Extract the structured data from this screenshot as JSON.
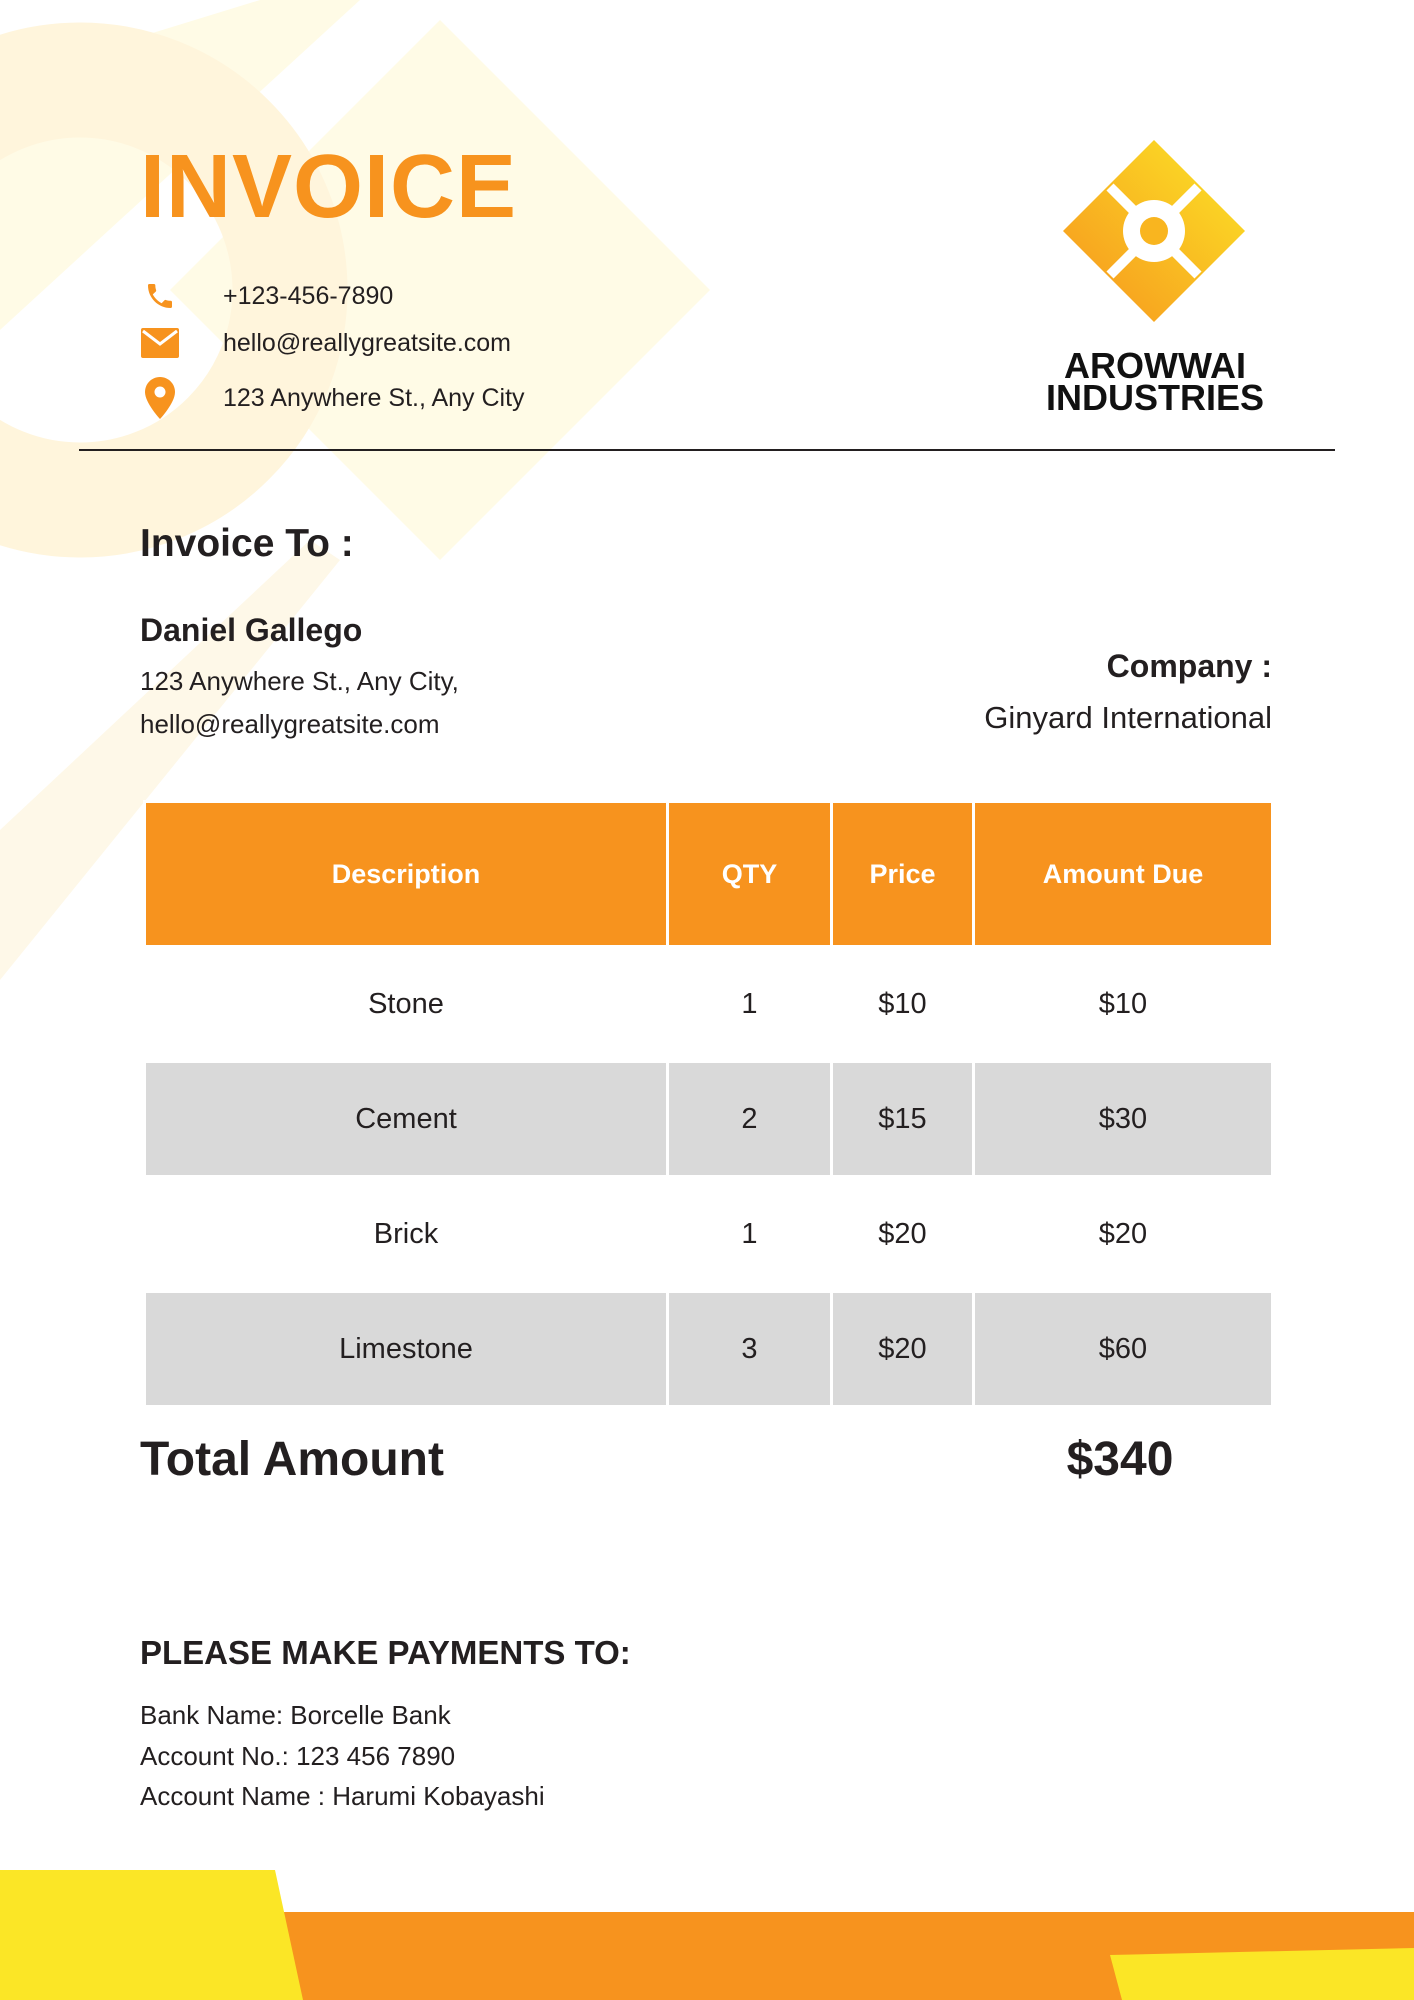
{
  "header": {
    "title": "INVOICE",
    "phone": "+123-456-7890",
    "email": "hello@reallygreatsite.com",
    "address": "123 Anywhere St., Any City",
    "icons": [
      "phone-icon",
      "mail-icon",
      "location-pin-icon"
    ]
  },
  "brand": {
    "name_line1": "AROWWAI",
    "name_line2": "INDUSTRIES",
    "logo_icon": "diamond-logo-icon"
  },
  "bill_to": {
    "heading": "Invoice To :",
    "name": "Daniel Gallego",
    "address": "123 Anywhere St., Any City,",
    "email": "hello@reallygreatsite.com",
    "company_label": "Company :",
    "company_name": "Ginyard International"
  },
  "table": {
    "headers": [
      "Description",
      "QTY",
      "Price",
      "Amount Due"
    ],
    "rows": [
      [
        "Stone",
        "1",
        "$10",
        "$10"
      ],
      [
        "Cement",
        "2",
        "$15",
        "$30"
      ],
      [
        "Brick",
        "1",
        "$20",
        "$20"
      ],
      [
        "Limestone",
        "3",
        "$20",
        "$60"
      ]
    ]
  },
  "total": {
    "label": "Total Amount",
    "value": "$340"
  },
  "payment": {
    "heading": "PLEASE MAKE PAYMENTS TO:",
    "bank": "Bank Name: Borcelle Bank",
    "account_no": "Account No.: 123 456 7890",
    "account_name": "Account Name : Harumi Kobayashi"
  },
  "colors": {
    "accent_orange": "#f7931e",
    "accent_yellow": "#fbe626",
    "text_dark": "#231f20",
    "row_gray": "#d9d9d9"
  }
}
